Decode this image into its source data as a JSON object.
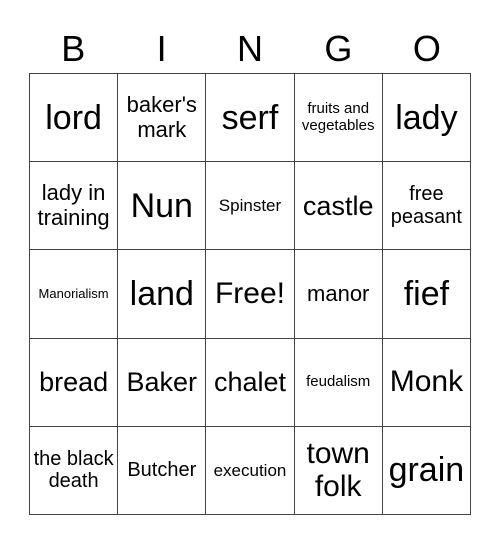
{
  "header": [
    "B",
    "I",
    "N",
    "G",
    "O"
  ],
  "cells": [
    [
      "lord",
      "baker's mark",
      "serf",
      "fruits and vegetables",
      "lady"
    ],
    [
      "lady in training",
      "Nun",
      "Spinster",
      "castle",
      "free peasant"
    ],
    [
      "Manorialism",
      "land",
      "Free!",
      "manor",
      "fief"
    ],
    [
      "bread",
      "Baker",
      "chalet",
      "feudalism",
      "Monk"
    ],
    [
      "the black death",
      "Butcher",
      "execution",
      "town folk",
      "grain"
    ]
  ]
}
